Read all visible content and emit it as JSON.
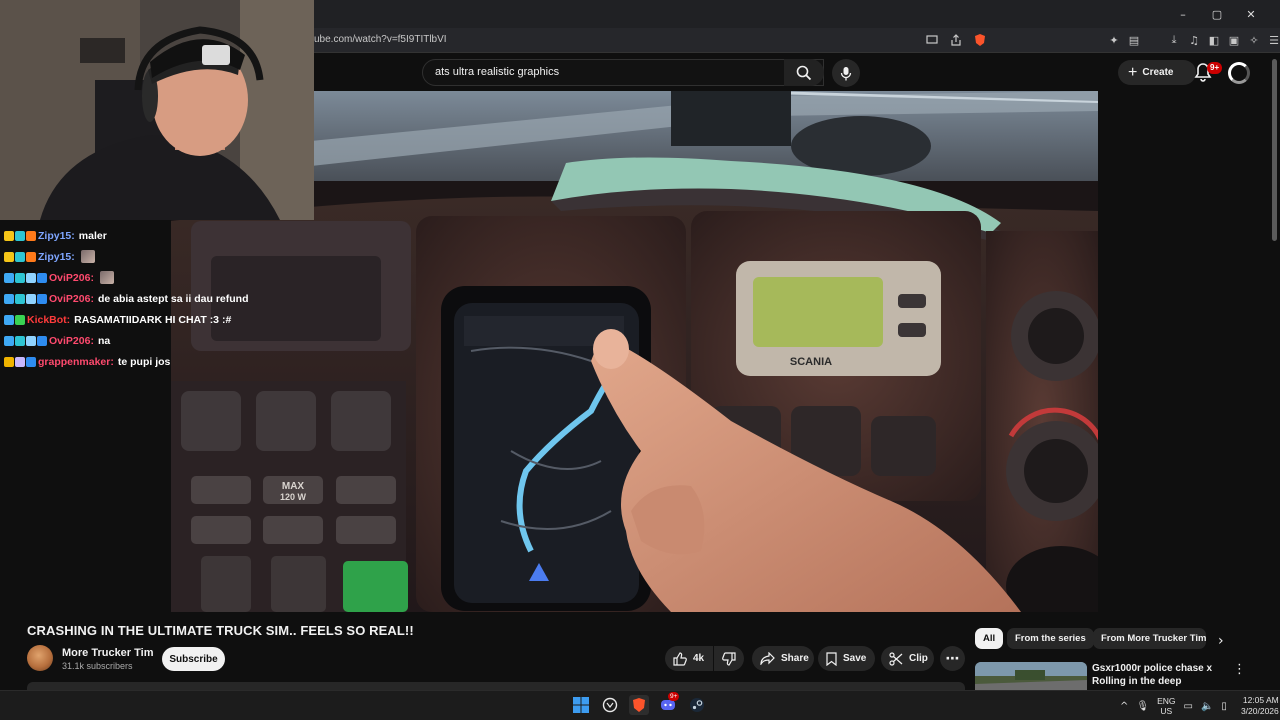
{
  "browser": {
    "url": "ube.com/watch?v=f5I9TITlbVI",
    "window_controls": {
      "minimize": "–",
      "maximize": "▢",
      "close": "✕"
    }
  },
  "youtube": {
    "search": {
      "value": "ats ultra realistic graphics"
    },
    "create_label": "Create",
    "notifications_badge": "9+"
  },
  "video": {
    "title": "CRASHING IN THE ULTIMATE TRUCK SIM.. FEELS SO REAL!!",
    "channel": {
      "name": "More Trucker Tim",
      "subscribers": "31.1k subscribers"
    },
    "subscribe_label": "Subscribe",
    "actions": {
      "likes": "4k",
      "share": "Share",
      "save": "Save",
      "clip": "Clip"
    },
    "overlay": {
      "dash_brand": "SCANIA",
      "button_max": "MAX",
      "button_watts": "120 W"
    }
  },
  "chat": [
    {
      "user": "Zipy15:",
      "message": "maler",
      "user_color": "#7fa6ff",
      "badges": [
        "crown",
        "cyan",
        "orange"
      ]
    },
    {
      "user": "Zipy15:",
      "message": "",
      "user_color": "#7fa6ff",
      "badges": [
        "crown",
        "cyan",
        "orange"
      ],
      "emote": true
    },
    {
      "user": "OviP206:",
      "message": "",
      "user_color": "#ff4a6e",
      "badges": [
        "sword",
        "cyan",
        "snow",
        "cube"
      ],
      "emote": true
    },
    {
      "user": "OviP206:",
      "message": "de abia astept sa ii dau refund",
      "user_color": "#ff4a6e",
      "badges": [
        "sword",
        "cyan",
        "snow",
        "cube"
      ]
    },
    {
      "user": "KickBot:",
      "message": "RASAMATIIDARK HI CHAT :3 :#",
      "user_color": "#ff3b3b",
      "badges": [
        "sword",
        "green"
      ]
    },
    {
      "user": "OviP206:",
      "message": "na",
      "user_color": "#ff4a6e",
      "badges": [
        "sword",
        "cyan",
        "snow",
        "cube"
      ]
    },
    {
      "user": "grappenmaker:",
      "message": "te pupi jos",
      "user_color": "#ff4a6e",
      "badges": [
        "warn",
        "star",
        "cube"
      ]
    }
  ],
  "recommendations": {
    "chips": [
      "All",
      "From the series",
      "From More Trucker Tim"
    ],
    "first_title": "Gsxr1000r police chase x Rolling in the deep"
  },
  "taskbar": {
    "language": "ENG",
    "region": "US",
    "time": "12:05 AM",
    "date": "3/20/2026",
    "discord_badge": "9+"
  },
  "colors": {
    "yt_background": "#0f0f0f",
    "chip_background": "#272727",
    "subscribe_background": "#f1f1f1",
    "notification_red": "#cc0000"
  }
}
